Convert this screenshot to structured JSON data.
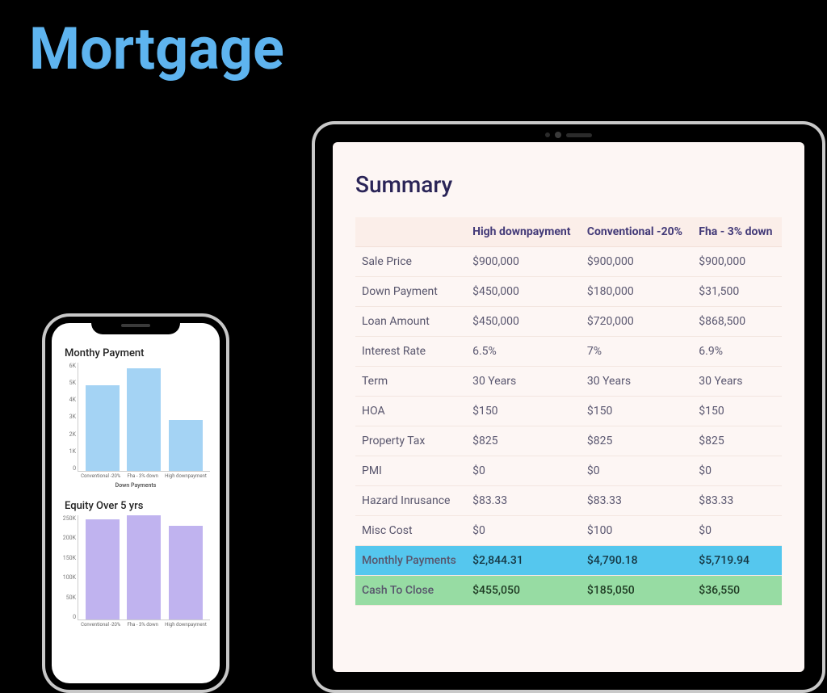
{
  "page_title": "Mortgage",
  "phone": {
    "chart1": {
      "title": "Monthy Payment",
      "xlabel": "Down Payments"
    },
    "chart2": {
      "title": "Equity  Over 5 yrs"
    }
  },
  "tablet": {
    "title": "Summary",
    "headers": [
      "",
      "High downpayment",
      "Conventional -20%",
      "Fha - 3% down"
    ],
    "rows": [
      {
        "label": "Sale Price",
        "c1": "$900,000",
        "c2": "$900,000",
        "c3": "$900,000"
      },
      {
        "label": "Down Payment",
        "c1": "$450,000",
        "c2": "$180,000",
        "c3": "$31,500"
      },
      {
        "label": "Loan Amount",
        "c1": "$450,000",
        "c2": "$720,000",
        "c3": "$868,500"
      },
      {
        "label": "Interest Rate",
        "c1": "6.5%",
        "c2": "7%",
        "c3": "6.9%"
      },
      {
        "label": "Term",
        "c1": "30 Years",
        "c2": "30 Years",
        "c3": "30 Years"
      },
      {
        "label": "HOA",
        "c1": "$150",
        "c2": "$150",
        "c3": "$150"
      },
      {
        "label": "Property Tax",
        "c1": "$825",
        "c2": "$825",
        "c3": "$825"
      },
      {
        "label": "PMI",
        "c1": "$0",
        "c2": "$0",
        "c3": "$0"
      },
      {
        "label": "Hazard Inrusance",
        "c1": "$83.33",
        "c2": "$83.33",
        "c3": "$83.33"
      },
      {
        "label": "Misc Cost",
        "c1": "$0",
        "c2": "$100",
        "c3": "$0"
      },
      {
        "label": "Monthly Payments",
        "c1": "$2,844.31",
        "c2": "$4,790.18",
        "c3": "$5,719.94",
        "hl": "blue"
      },
      {
        "label": "Cash To Close",
        "c1": "$455,050",
        "c2": "$185,050",
        "c3": "$36,550",
        "hl": "green"
      }
    ]
  },
  "chart_data": [
    {
      "type": "bar",
      "title": "Monthy Payment",
      "xlabel": "Down Payments",
      "ylabel": "",
      "ylim": [
        0,
        6000
      ],
      "y_ticks": [
        "6K",
        "5K",
        "4K",
        "3K",
        "2K",
        "1K",
        "0"
      ],
      "categories": [
        "Conventional -20%",
        "Fha - 3% down",
        "High downpayment"
      ],
      "values": [
        4790,
        5720,
        2844
      ],
      "color": "#a4d3f4"
    },
    {
      "type": "bar",
      "title": "Equity  Over 5 yrs",
      "xlabel": "",
      "ylabel": "",
      "ylim": [
        0,
        250000
      ],
      "y_ticks": [
        "250K",
        "200K",
        "150K",
        "100K",
        "50K",
        "0"
      ],
      "categories": [
        "Conventional -20%",
        "Fha - 3% down",
        "High downpayment"
      ],
      "values": [
        240000,
        250000,
        225000
      ],
      "color": "#c0b3ef"
    }
  ]
}
